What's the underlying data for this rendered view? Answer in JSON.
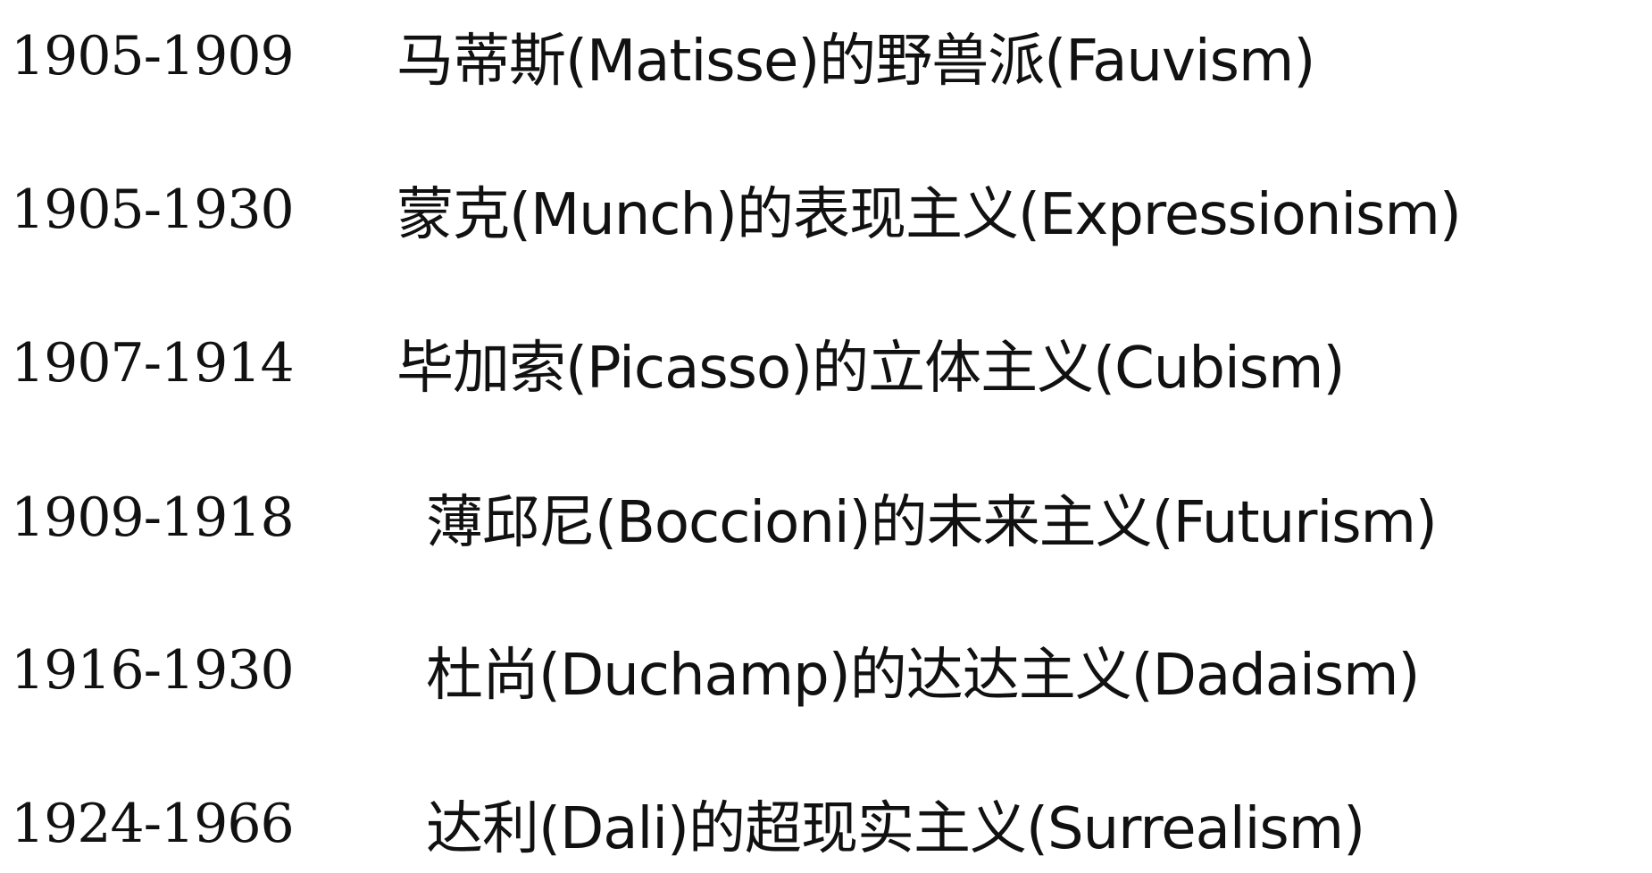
{
  "timeline": [
    {
      "years": "1905-1909",
      "movement": "马蒂斯(Matisse)的野兽派(Fauvism)"
    },
    {
      "years": "1905-1930",
      "movement": "蒙克(Munch)的表现主义(Expressionism)"
    },
    {
      "years": "1907-1914",
      "movement": "毕加索(Picasso)的立体主义(Cubism)"
    },
    {
      "years": "1909-1918",
      "movement": "薄邱尼(Boccioni)的未来主义(Futurism)"
    },
    {
      "years": "1916-1930",
      "movement": "杜尚(Duchamp)的达达主义(Dadaism)"
    },
    {
      "years": "1924-1966",
      "movement": "达利(Dali)的超现实主义(Surrealism)"
    }
  ]
}
